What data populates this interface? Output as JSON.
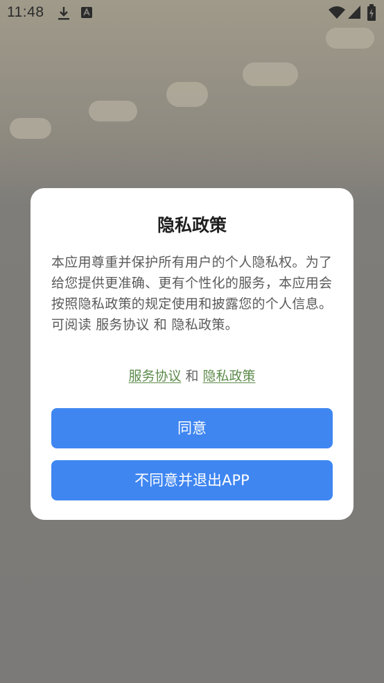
{
  "status_bar": {
    "time": "11:48",
    "icons": [
      "download-icon",
      "font-icon",
      "wifi-icon",
      "signal-icon",
      "battery-icon"
    ]
  },
  "dialog": {
    "title": "隐私政策",
    "body": "本应用尊重并保护所有用户的个人隐私权。为了给您提供更准确、更有个性化的服务，本应用会按照隐私政策的规定使用和披露您的个人信息。可阅读 服务协议 和 隐私政策。",
    "link_service": "服务协议",
    "link_separator": "和",
    "link_privacy": "隐私政策",
    "agree_label": "同意",
    "disagree_label": "不同意并退出APP"
  },
  "colors": {
    "button": "#3f86f1",
    "link": "#5c8a4a",
    "overlay": "#7c7a76"
  }
}
